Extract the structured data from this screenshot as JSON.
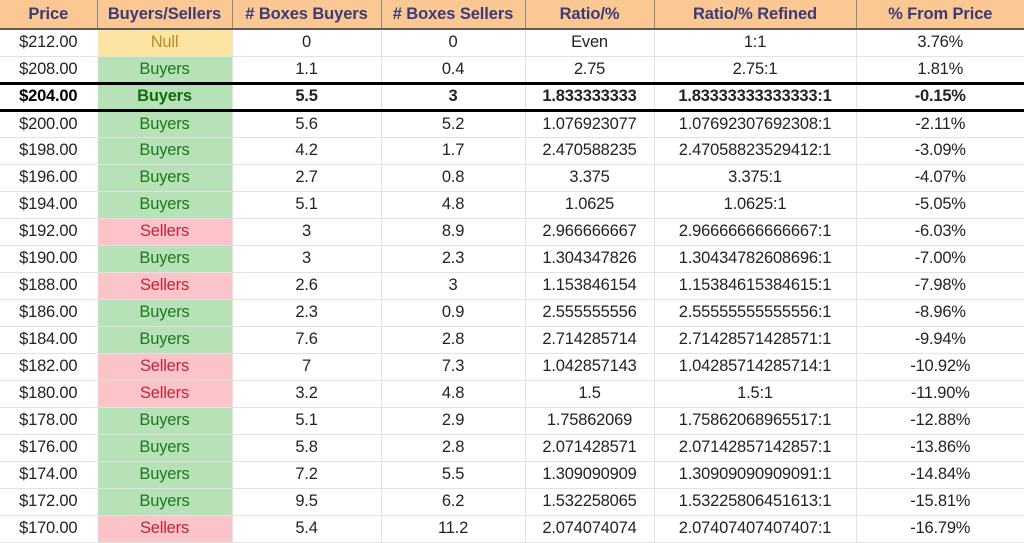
{
  "table": {
    "headers": [
      {
        "key": "price",
        "label": "Price"
      },
      {
        "key": "sentiment",
        "label": "Buyers/Sellers"
      },
      {
        "key": "boxes_buy",
        "label": "# Boxes Buyers"
      },
      {
        "key": "boxes_sel",
        "label": "# Boxes Sellers"
      },
      {
        "key": "ratio",
        "label": "Ratio/%"
      },
      {
        "key": "ratio_ref",
        "label": "Ratio/% Refined"
      },
      {
        "key": "pct_from",
        "label": "% From Price"
      }
    ],
    "colors": {
      "header_bg": "#FBC893",
      "header_text": "#3B3B77",
      "buyers_bg": "#B7E1B7",
      "buyers_text": "#1B7A1B",
      "sellers_bg": "#FAC4C8",
      "sellers_text": "#C3223A",
      "null_bg": "#FCE5A2",
      "null_text": "#BE8A22",
      "cell_text": "#232323",
      "grid_line": "#e2e2e2",
      "focus_border": "#000000"
    },
    "focus_row_index": 2,
    "rows": [
      {
        "price": "$212.00",
        "sentiment": "Null",
        "sentiment_kind": "null",
        "boxes_buy": "0",
        "boxes_sel": "0",
        "ratio": "Even",
        "ratio_ref": "1:1",
        "pct_from": "3.76%"
      },
      {
        "price": "$208.00",
        "sentiment": "Buyers",
        "sentiment_kind": "buyers",
        "boxes_buy": "1.1",
        "boxes_sel": "0.4",
        "ratio": "2.75",
        "ratio_ref": "2.75:1",
        "pct_from": "1.81%"
      },
      {
        "price": "$204.00",
        "sentiment": "Buyers",
        "sentiment_kind": "buyers",
        "boxes_buy": "5.5",
        "boxes_sel": "3",
        "ratio": "1.833333333",
        "ratio_ref": "1.83333333333333:1",
        "pct_from": "-0.15%"
      },
      {
        "price": "$200.00",
        "sentiment": "Buyers",
        "sentiment_kind": "buyers",
        "boxes_buy": "5.6",
        "boxes_sel": "5.2",
        "ratio": "1.076923077",
        "ratio_ref": "1.07692307692308:1",
        "pct_from": "-2.11%"
      },
      {
        "price": "$198.00",
        "sentiment": "Buyers",
        "sentiment_kind": "buyers",
        "boxes_buy": "4.2",
        "boxes_sel": "1.7",
        "ratio": "2.470588235",
        "ratio_ref": "2.47058823529412:1",
        "pct_from": "-3.09%"
      },
      {
        "price": "$196.00",
        "sentiment": "Buyers",
        "sentiment_kind": "buyers",
        "boxes_buy": "2.7",
        "boxes_sel": "0.8",
        "ratio": "3.375",
        "ratio_ref": "3.375:1",
        "pct_from": "-4.07%"
      },
      {
        "price": "$194.00",
        "sentiment": "Buyers",
        "sentiment_kind": "buyers",
        "boxes_buy": "5.1",
        "boxes_sel": "4.8",
        "ratio": "1.0625",
        "ratio_ref": "1.0625:1",
        "pct_from": "-5.05%"
      },
      {
        "price": "$192.00",
        "sentiment": "Sellers",
        "sentiment_kind": "sellers",
        "boxes_buy": "3",
        "boxes_sel": "8.9",
        "ratio": "2.966666667",
        "ratio_ref": "2.96666666666667:1",
        "pct_from": "-6.03%"
      },
      {
        "price": "$190.00",
        "sentiment": "Buyers",
        "sentiment_kind": "buyers",
        "boxes_buy": "3",
        "boxes_sel": "2.3",
        "ratio": "1.304347826",
        "ratio_ref": "1.30434782608696:1",
        "pct_from": "-7.00%"
      },
      {
        "price": "$188.00",
        "sentiment": "Sellers",
        "sentiment_kind": "sellers",
        "boxes_buy": "2.6",
        "boxes_sel": "3",
        "ratio": "1.153846154",
        "ratio_ref": "1.15384615384615:1",
        "pct_from": "-7.98%"
      },
      {
        "price": "$186.00",
        "sentiment": "Buyers",
        "sentiment_kind": "buyers",
        "boxes_buy": "2.3",
        "boxes_sel": "0.9",
        "ratio": "2.555555556",
        "ratio_ref": "2.55555555555556:1",
        "pct_from": "-8.96%"
      },
      {
        "price": "$184.00",
        "sentiment": "Buyers",
        "sentiment_kind": "buyers",
        "boxes_buy": "7.6",
        "boxes_sel": "2.8",
        "ratio": "2.714285714",
        "ratio_ref": "2.71428571428571:1",
        "pct_from": "-9.94%"
      },
      {
        "price": "$182.00",
        "sentiment": "Sellers",
        "sentiment_kind": "sellers",
        "boxes_buy": "7",
        "boxes_sel": "7.3",
        "ratio": "1.042857143",
        "ratio_ref": "1.04285714285714:1",
        "pct_from": "-10.92%"
      },
      {
        "price": "$180.00",
        "sentiment": "Sellers",
        "sentiment_kind": "sellers",
        "boxes_buy": "3.2",
        "boxes_sel": "4.8",
        "ratio": "1.5",
        "ratio_ref": "1.5:1",
        "pct_from": "-11.90%"
      },
      {
        "price": "$178.00",
        "sentiment": "Buyers",
        "sentiment_kind": "buyers",
        "boxes_buy": "5.1",
        "boxes_sel": "2.9",
        "ratio": "1.75862069",
        "ratio_ref": "1.75862068965517:1",
        "pct_from": "-12.88%"
      },
      {
        "price": "$176.00",
        "sentiment": "Buyers",
        "sentiment_kind": "buyers",
        "boxes_buy": "5.8",
        "boxes_sel": "2.8",
        "ratio": "2.071428571",
        "ratio_ref": "2.07142857142857:1",
        "pct_from": "-13.86%"
      },
      {
        "price": "$174.00",
        "sentiment": "Buyers",
        "sentiment_kind": "buyers",
        "boxes_buy": "7.2",
        "boxes_sel": "5.5",
        "ratio": "1.309090909",
        "ratio_ref": "1.30909090909091:1",
        "pct_from": "-14.84%"
      },
      {
        "price": "$172.00",
        "sentiment": "Buyers",
        "sentiment_kind": "buyers",
        "boxes_buy": "9.5",
        "boxes_sel": "6.2",
        "ratio": "1.532258065",
        "ratio_ref": "1.53225806451613:1",
        "pct_from": "-15.81%"
      },
      {
        "price": "$170.00",
        "sentiment": "Sellers",
        "sentiment_kind": "sellers",
        "boxes_buy": "5.4",
        "boxes_sel": "11.2",
        "ratio": "2.074074074",
        "ratio_ref": "2.07407407407407:1",
        "pct_from": "-16.79%"
      }
    ]
  }
}
